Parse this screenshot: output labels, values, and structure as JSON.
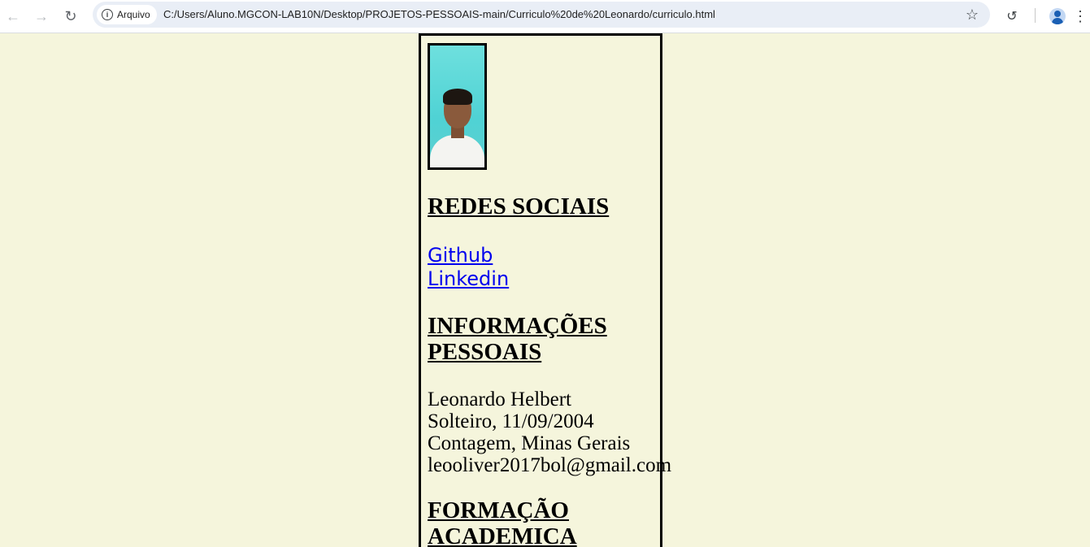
{
  "browser": {
    "site_info_label": "Arquivo",
    "url": "C:/Users/Aluno.MGCON-LAB10N/Desktop/PROJETOS-PESSOAIS-main/Curriculo%20de%20Leonardo/curriculo.html",
    "icons": {
      "back": "arrow-left-icon",
      "forward": "arrow-right-icon",
      "reload": "reload-icon",
      "site_info": "info-icon",
      "bookmark": "star-icon",
      "history": "history-icon",
      "profile": "profile-icon",
      "menu": "kebab-menu-icon"
    }
  },
  "resume": {
    "social_heading": "REDES SOCIAIS",
    "links": [
      {
        "label": "Github"
      },
      {
        "label": "Linkedin"
      }
    ],
    "personal_heading_line1": "INFORMAÇÕES",
    "personal_heading_line2": "PESSOAIS",
    "personal_info": [
      "Leonardo Helbert",
      "Solteiro, 11/09/2004",
      "Contagem, Minas Gerais",
      "leooliver2017bol@gmail.com"
    ],
    "education_heading_line1": "FORMAÇÃO",
    "education_heading_line2": "ACADEMICA"
  },
  "colors": {
    "page_background": "#f5f5dc",
    "link": "#0000ee",
    "border": "#000000"
  }
}
